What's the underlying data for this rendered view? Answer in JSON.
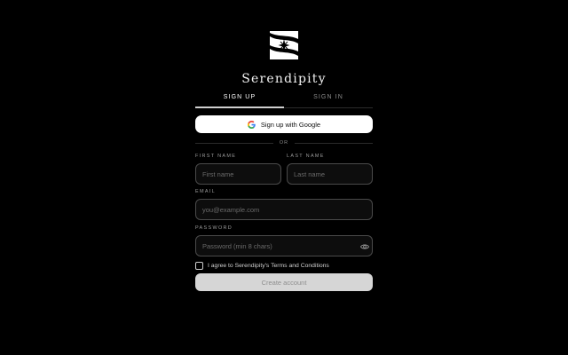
{
  "brand": {
    "name": "Serendipity"
  },
  "tabs": [
    {
      "label": "SIGN UP",
      "active": true
    },
    {
      "label": "SIGN IN",
      "active": false
    }
  ],
  "google_button": {
    "label": "Sign up with Google"
  },
  "divider": {
    "label": "OR"
  },
  "form": {
    "first_name": {
      "label": "FIRST NAME",
      "placeholder": "First name",
      "value": ""
    },
    "last_name": {
      "label": "LAST NAME",
      "placeholder": "Last name",
      "value": ""
    },
    "email": {
      "label": "EMAIL",
      "placeholder": "you@example.com",
      "value": ""
    },
    "password": {
      "label": "PASSWORD",
      "placeholder": "Password (min 8 chars)",
      "value": ""
    }
  },
  "agree": {
    "label": "I agree to Serendipity's Terms and Conditions",
    "checked": false
  },
  "submit": {
    "label": "Create account"
  },
  "colors": {
    "background": "#000000",
    "button_primary_bg": "#ffffff",
    "submit_disabled_bg": "#d6d6d6",
    "field_border": "#4a4a4a"
  },
  "icons": [
    "serendipity-logo-icon",
    "google-icon",
    "eye-icon",
    "checkbox-icon"
  ]
}
